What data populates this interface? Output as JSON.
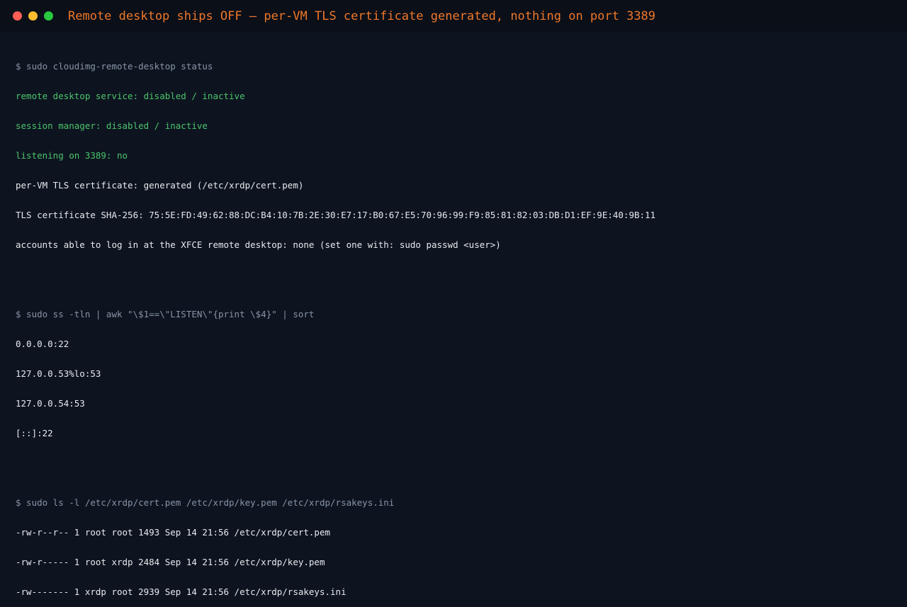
{
  "colors": {
    "background": "#0d1420",
    "titlebar": "#0a0f18",
    "title_text": "#f0782a",
    "prompt": "#8893a6",
    "green": "#4cc46a",
    "output": "#e6e9ee",
    "dot_red": "#ff5f57",
    "dot_yellow": "#febc2e",
    "dot_green": "#28c840"
  },
  "window": {
    "title": "Remote desktop ships OFF — per-VM TLS certificate generated, nothing on port 3389"
  },
  "terminal": {
    "block1": {
      "command": "$ sudo cloudimg-remote-desktop status",
      "status_lines": [
        "remote desktop service: disabled / inactive",
        "session manager: disabled / inactive",
        "listening on 3389: no"
      ],
      "output_lines": [
        "per-VM TLS certificate: generated (/etc/xrdp/cert.pem)",
        "TLS certificate SHA-256: 75:5E:FD:49:62:88:DC:B4:10:7B:2E:30:E7:17:B0:67:E5:70:96:99:F9:85:81:82:03:DB:D1:EF:9E:40:9B:11",
        "accounts able to log in at the XFCE remote desktop: none (set one with: sudo passwd <user>)"
      ]
    },
    "block2": {
      "command": "$ sudo ss -tln | awk \"\\$1==\\\"LISTEN\\\"{print \\$4}\" | sort",
      "output_lines": [
        "0.0.0.0:22",
        "127.0.0.53%lo:53",
        "127.0.0.54:53",
        "[::]:22"
      ]
    },
    "block3": {
      "command": "$ sudo ls -l /etc/xrdp/cert.pem /etc/xrdp/key.pem /etc/xrdp/rsakeys.ini",
      "output_lines": [
        "-rw-r--r-- 1 root root 1493 Sep 14 21:56 /etc/xrdp/cert.pem",
        "-rw-r----- 1 root xrdp 2484 Sep 14 21:56 /etc/xrdp/key.pem",
        "-rw------- 1 xrdp root 2939 Sep 14 21:56 /etc/xrdp/rsakeys.ini"
      ]
    }
  }
}
